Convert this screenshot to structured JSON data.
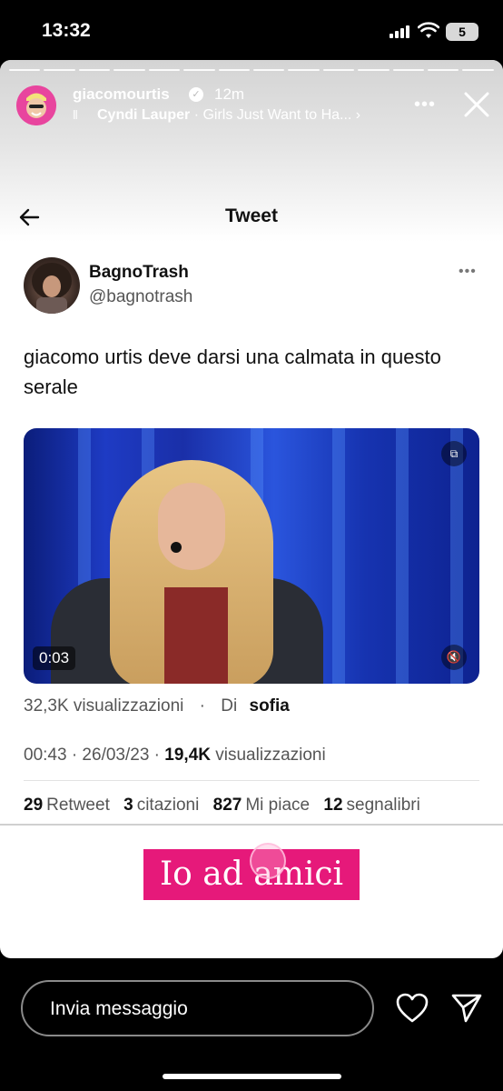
{
  "status_bar": {
    "time": "13:32",
    "battery": "5"
  },
  "story": {
    "username": "giacomourtis",
    "time_ago": "12m",
    "music_artist": "Cyndi Lauper",
    "music_title": "· Girls Just Want to Ha... ›",
    "segments": 14
  },
  "tweet": {
    "header_title": "Tweet",
    "author_name": "BagnoTrash",
    "author_handle": "@bagnotrash",
    "text": "giacomo urtis deve darsi una calmata in questo serale",
    "video_time": "0:03",
    "video_views": "32,3K visualizzazioni",
    "video_by": "Di",
    "video_by_name": "sofia",
    "posted_time": "00:43 · 26/03/23 · ",
    "total_views": "19,4K",
    "total_views_label": "visualizzazioni",
    "stats": [
      {
        "count": "29",
        "label": "Retweet"
      },
      {
        "count": "3",
        "label": "citazioni"
      },
      {
        "count": "827",
        "label": "Mi piace"
      },
      {
        "count": "12",
        "label": "segnalibri"
      }
    ]
  },
  "sticker": {
    "text": "Io ad amici"
  },
  "bottom": {
    "message_placeholder": "Invia messaggio"
  },
  "colors": {
    "sticker_pink": "#e6197a",
    "video_blue": "#1e3bc4",
    "avatar_pink": "#e8459e"
  }
}
